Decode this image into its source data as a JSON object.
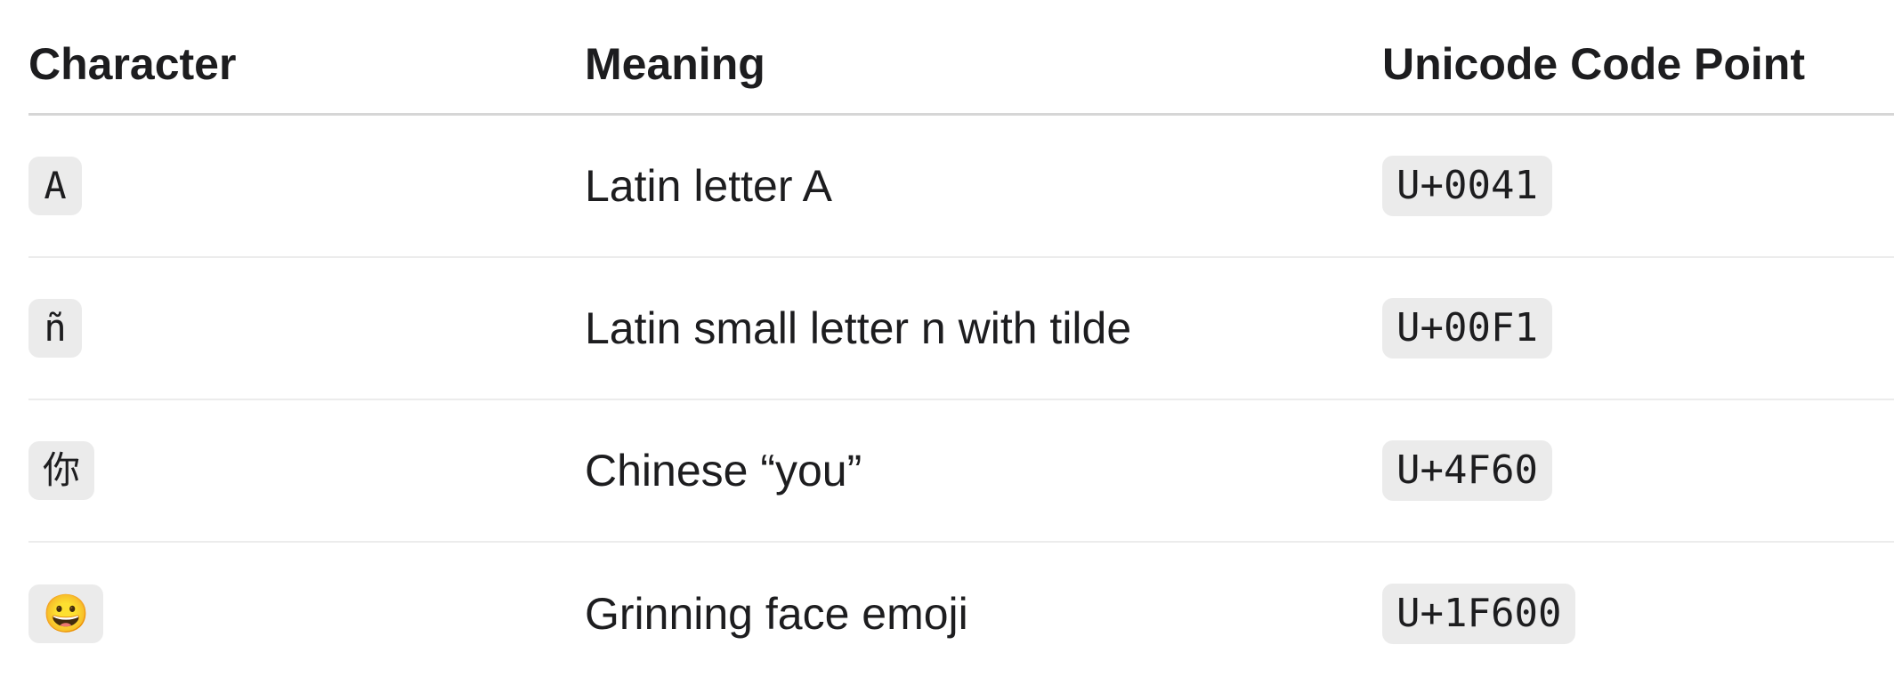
{
  "table": {
    "headers": {
      "character": "Character",
      "meaning": "Meaning",
      "code_point": "Unicode Code Point"
    },
    "rows": [
      {
        "character": "A",
        "meaning": "Latin letter A",
        "code_point": "U+0041"
      },
      {
        "character": "ñ",
        "meaning": "Latin small letter n with tilde",
        "code_point": "U+00F1"
      },
      {
        "character": "你",
        "meaning": "Chinese “you”",
        "code_point": "U+4F60"
      },
      {
        "character": "😀",
        "meaning": "Grinning face emoji",
        "code_point": "U+1F600"
      }
    ]
  }
}
